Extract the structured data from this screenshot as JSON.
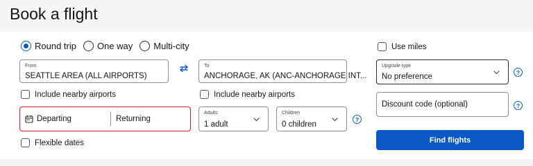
{
  "title": "Book a flight",
  "trip_type": {
    "options": [
      "Round trip",
      "One way",
      "Multi-city"
    ],
    "selected": "Round trip"
  },
  "from": {
    "label": "From",
    "value": "SEATTLE AREA (ALL AIRPORTS)"
  },
  "to": {
    "label": "To",
    "value": "ANCHORAGE, AK (ANC-ANCHORAGE INT..."
  },
  "nearby_from": "Include nearby airports",
  "nearby_to": "Include nearby airports",
  "dates": {
    "departing": "Departing",
    "returning": "Returning"
  },
  "adults": {
    "label": "Adults",
    "value": "1 adult"
  },
  "children": {
    "label": "Children",
    "value": "0 children"
  },
  "flexible_dates": "Flexible dates",
  "use_miles": "Use miles",
  "upgrade": {
    "label": "Upgrade type",
    "value": "No preference"
  },
  "discount_placeholder": "Discount code (optional)",
  "help_glyph": "?",
  "find_button": "Find flights",
  "colors": {
    "accent": "#0a59c7",
    "error": "#d11a2a"
  }
}
